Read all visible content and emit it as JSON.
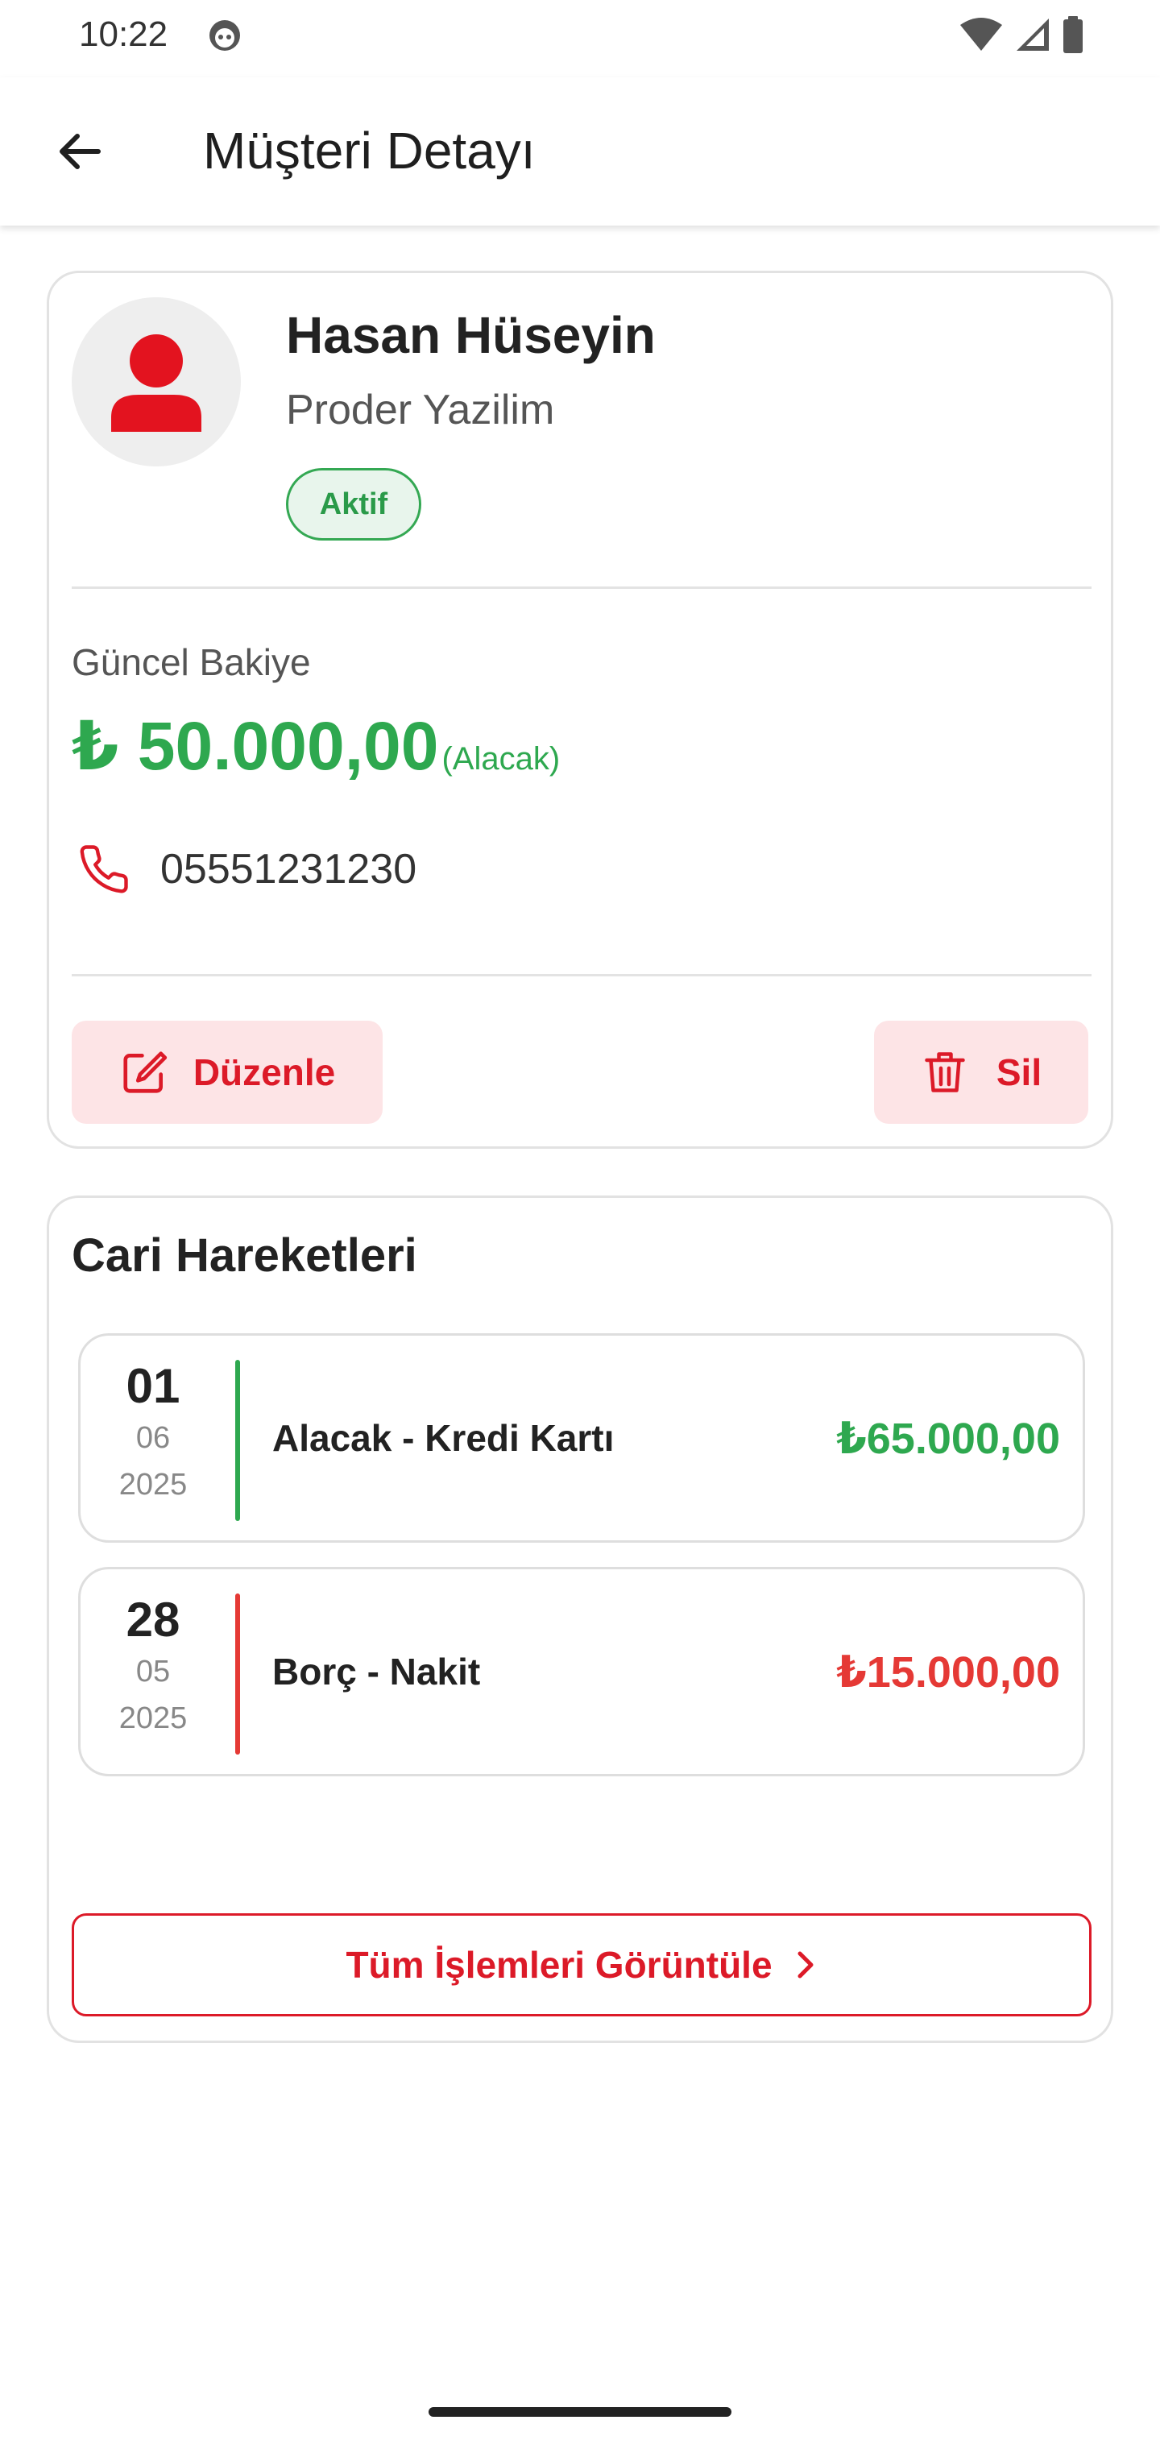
{
  "status_bar": {
    "time": "10:22",
    "icons": [
      "face-icon",
      "wifi-icon",
      "signal-icon",
      "battery-icon"
    ]
  },
  "app_bar": {
    "title": "Müşteri Detayı",
    "back_icon": "arrow-left-icon"
  },
  "customer": {
    "name": "Hasan Hüseyin",
    "company": "Proder Yazilim",
    "status": "Aktif",
    "balance_label": "Güncel Bakiye",
    "balance_amount": "₺ 50.000,00",
    "balance_type": "(Alacak)",
    "phone": "05551231230",
    "edit_label": "Düzenle",
    "delete_label": "Sil"
  },
  "transactions": {
    "heading": "Cari Hareketleri",
    "items": [
      {
        "day": "01",
        "month": "06",
        "year": "2025",
        "description": "Alacak - Kredi Kartı",
        "amount": "₺65.000,00",
        "kind": "credit"
      },
      {
        "day": "28",
        "month": "05",
        "year": "2025",
        "description": "Borç - Nakit",
        "amount": "₺15.000,00",
        "kind": "debit"
      }
    ],
    "view_all_label": "Tüm İşlemleri Görüntüle"
  },
  "colors": {
    "accent_red": "#dc1a28",
    "credit_green": "#2ea84f",
    "debit_red": "#e53935",
    "button_tint": "#fde4e6"
  }
}
